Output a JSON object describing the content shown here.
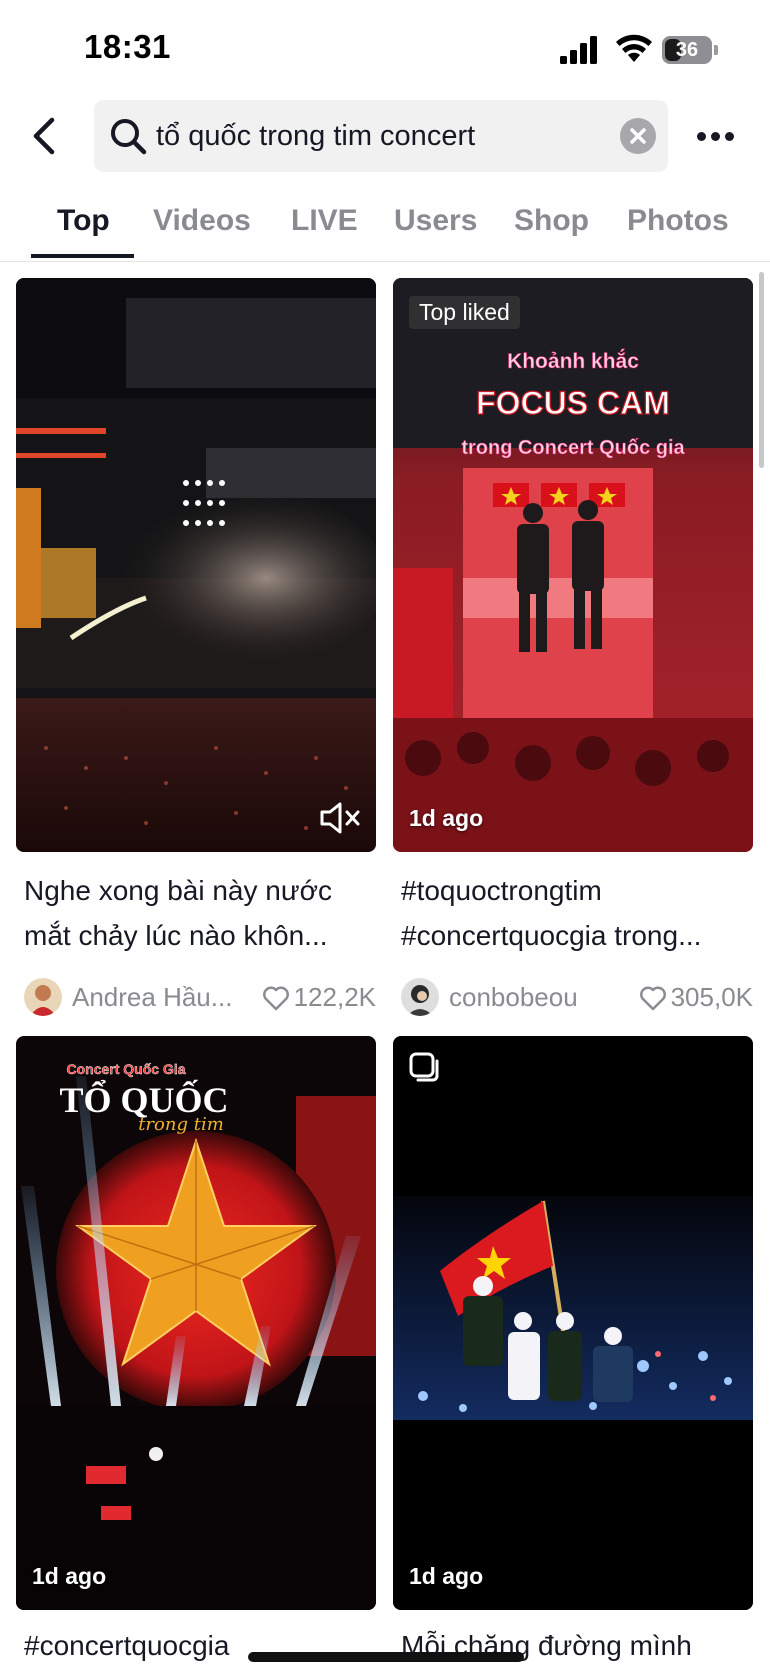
{
  "status_bar": {
    "time": "18:31",
    "battery": "36",
    "battery_level": 0.36
  },
  "search": {
    "query": "tổ quốc trong tim concert"
  },
  "tabs": [
    {
      "label": "Top",
      "active": true
    },
    {
      "label": "Videos",
      "active": false
    },
    {
      "label": "LIVE",
      "active": false
    },
    {
      "label": "Users",
      "active": false
    },
    {
      "label": "Shop",
      "active": false
    },
    {
      "label": "Photos",
      "active": false
    }
  ],
  "results": [
    {
      "caption": " Nghe xong bài này nước mắt chảy lúc nào khôn...",
      "author": "Andrea Hầu...",
      "likes": "122,2K",
      "muted": true
    },
    {
      "badge": "Top liked",
      "time": "1d ago",
      "overlay_lines": [
        "Khoảnh khắc",
        "FOCUS CAM",
        "trong Concert Quốc gia"
      ],
      "caption": "#toquoctrongtim #concertquocgia trong...",
      "author": "conbobeou",
      "likes": "305,0K"
    },
    {
      "time": "1d ago",
      "overlay_lines": [
        "Concert Quốc Gia",
        "TỔ QUỐC",
        "trong tim"
      ],
      "caption": "#concertquocgia"
    },
    {
      "time": "1d ago",
      "caption": "Mỗi chặng đường mình",
      "photo_set": true
    }
  ],
  "colors": {
    "accent_red": "#e0131b",
    "text": "#161823",
    "muted": "#8a8b91"
  }
}
